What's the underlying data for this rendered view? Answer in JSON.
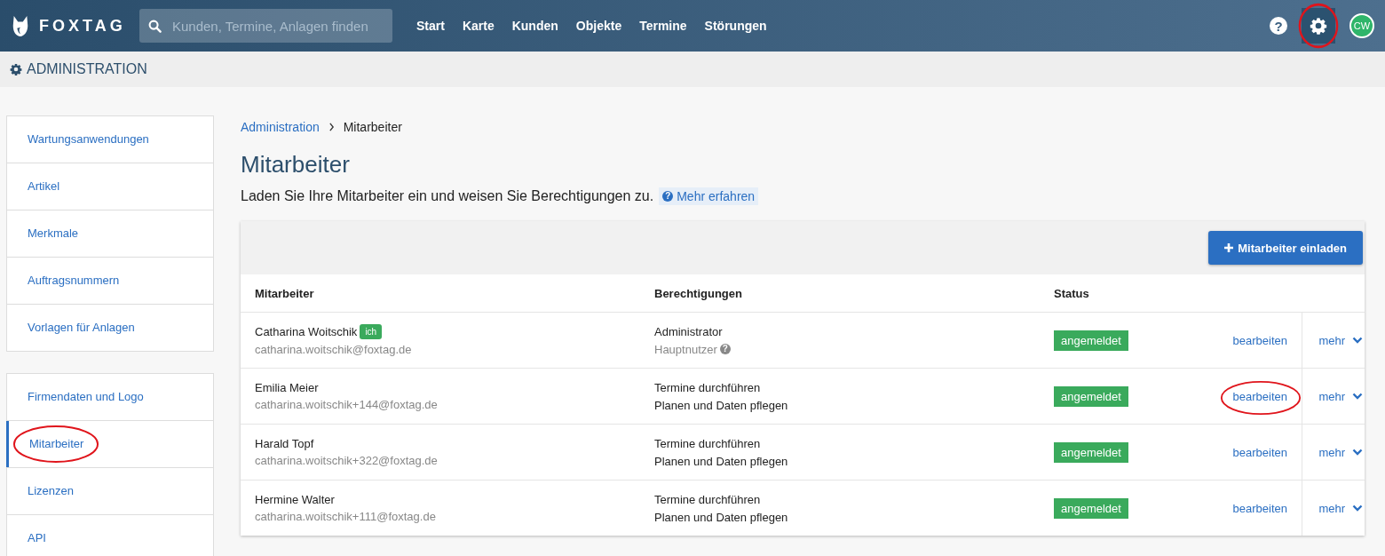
{
  "header": {
    "brand": "FOXTAG",
    "search": {
      "placeholder": "Kunden, Termine, Anlagen finden"
    },
    "nav": [
      {
        "label": "Start"
      },
      {
        "label": "Karte"
      },
      {
        "label": "Kunden"
      },
      {
        "label": "Objekte"
      },
      {
        "label": "Termine"
      },
      {
        "label": "Störungen"
      }
    ],
    "help_icon": "?",
    "settings": {
      "selected": true,
      "circled": true
    },
    "avatar": "CW"
  },
  "section_title": "ADMINISTRATION",
  "sidebar": {
    "groups": [
      [
        {
          "label": "Wartungsanwendungen",
          "selected": false,
          "circled": false
        },
        {
          "label": "Artikel",
          "selected": false,
          "circled": false
        },
        {
          "label": "Merkmale",
          "selected": false,
          "circled": false
        },
        {
          "label": "Auftragsnummern",
          "selected": false,
          "circled": false
        },
        {
          "label": "Vorlagen für Anlagen",
          "selected": false,
          "circled": false
        }
      ],
      [
        {
          "label": "Firmendaten und Logo",
          "selected": false,
          "circled": false
        },
        {
          "label": "Mitarbeiter",
          "selected": true,
          "circled": true
        },
        {
          "label": "Lizenzen",
          "selected": false,
          "circled": false
        },
        {
          "label": "API",
          "selected": false,
          "circled": false
        }
      ]
    ]
  },
  "breadcrumb": [
    {
      "label": "Administration"
    },
    {
      "label": "Mitarbeiter"
    }
  ],
  "title": "Mitarbeiter",
  "intro": "Laden Sie Ihre Mitarbeiter ein und weisen Sie Berechtigungen zu.",
  "learn_more_icon": "?",
  "learn_more": "Mehr erfahren",
  "invite_button": "Mitarbeiter einladen",
  "table": {
    "columns": [
      "Mitarbeiter",
      "Berechtigungen",
      "Status"
    ],
    "rows": [
      {
        "name": "Catharina Woitschik",
        "badge": "ich",
        "email": "catharina.woitschik@foxtag.de",
        "permissions": [
          {
            "text": "Administrator",
            "kind": "main"
          },
          {
            "text": "Hauptnutzer",
            "kind": "note",
            "icon": "?"
          }
        ],
        "status": "angemeldet",
        "edit": "bearbeiten",
        "edit_circled": false,
        "more": "mehr"
      },
      {
        "name": "Emilia Meier",
        "email": "catharina.woitschik+144@foxtag.de",
        "permissions": [
          {
            "text": "Termine durchführen",
            "kind": "main"
          },
          {
            "text": "Planen und Daten pflegen",
            "kind": "main"
          }
        ],
        "status": "angemeldet",
        "edit": "bearbeiten",
        "edit_circled": true,
        "more": "mehr"
      },
      {
        "name": "Harald Topf",
        "email": "catharina.woitschik+322@foxtag.de",
        "permissions": [
          {
            "text": "Termine durchführen",
            "kind": "main"
          },
          {
            "text": "Planen und Daten pflegen",
            "kind": "main"
          }
        ],
        "status": "angemeldet",
        "edit": "bearbeiten",
        "edit_circled": false,
        "more": "mehr"
      },
      {
        "name": "Hermine Walter",
        "email": "catharina.woitschik+111@foxtag.de",
        "permissions": [
          {
            "text": "Termine durchführen",
            "kind": "main"
          },
          {
            "text": "Planen und Daten pflegen",
            "kind": "main"
          }
        ],
        "status": "angemeldet",
        "edit": "bearbeiten",
        "edit_circled": false,
        "more": "mehr"
      }
    ]
  }
}
